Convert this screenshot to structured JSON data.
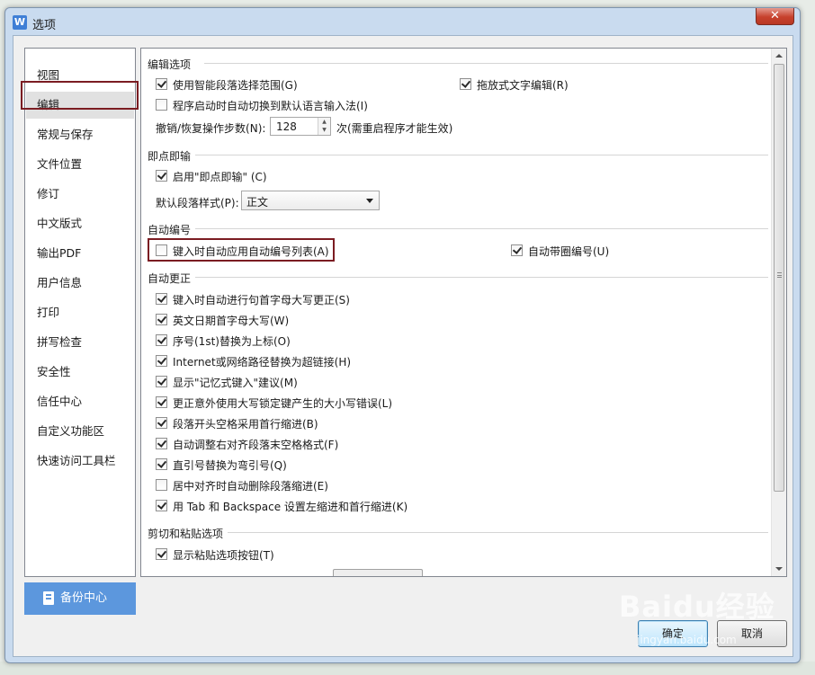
{
  "window": {
    "title": "选项",
    "app_icon_glyph": "W",
    "close_glyph": "✕"
  },
  "nav": {
    "items": [
      {
        "label": "视图"
      },
      {
        "label": "编辑",
        "active": true
      },
      {
        "label": "常规与保存"
      },
      {
        "label": "文件位置"
      },
      {
        "label": "修订"
      },
      {
        "label": "中文版式"
      },
      {
        "label": "输出PDF"
      },
      {
        "label": "用户信息"
      },
      {
        "label": "打印"
      },
      {
        "label": "拼写检查"
      },
      {
        "label": "安全性"
      },
      {
        "label": "信任中心"
      },
      {
        "label": "自定义功能区"
      },
      {
        "label": "快速访问工具栏"
      }
    ],
    "backup_label": "备份中心"
  },
  "edit": {
    "section_title": "编辑选项",
    "smart_select": {
      "label": "使用智能段落选择范围(G)",
      "checked": true
    },
    "drag_edit": {
      "label": "拖放式文字编辑(R)",
      "checked": true
    },
    "auto_ime": {
      "label": "程序启动时自动切换到默认语言输入法(I)",
      "checked": false
    },
    "undo_label": "撤销/恢复操作步数(N):",
    "undo_value": "128",
    "undo_note": "次(需重启程序才能生效)"
  },
  "click_type": {
    "section_title": "即点即输",
    "enable": {
      "label": "启用\"即点即输\" (C)",
      "checked": true
    },
    "default_style_label": "默认段落样式(P):",
    "default_style_value": "正文"
  },
  "auto_numbering": {
    "section_title": "自动编号",
    "apply_list": {
      "label": "键入时自动应用自动编号列表(A)",
      "checked": false
    },
    "circle_number": {
      "label": "自动带圈编号(U)",
      "checked": true
    }
  },
  "autocorrect": {
    "section_title": "自动更正",
    "options": [
      {
        "label": "键入时自动进行句首字母大写更正(S)",
        "checked": true
      },
      {
        "label": "英文日期首字母大写(W)",
        "checked": true
      },
      {
        "label": "序号(1st)替换为上标(O)",
        "checked": true
      },
      {
        "label": "Internet或网络路径替换为超链接(H)",
        "checked": true
      },
      {
        "label": "显示\"记忆式键入\"建议(M)",
        "checked": true
      },
      {
        "label": "更正意外使用大写锁定键产生的大小写错误(L)",
        "checked": true
      },
      {
        "label": "段落开头空格采用首行缩进(B)",
        "checked": true
      },
      {
        "label": "自动调整右对齐段落末空格格式(F)",
        "checked": true
      },
      {
        "label": "直引号替换为弯引号(Q)",
        "checked": true
      },
      {
        "label": "居中对齐时自动删除段落缩进(E)",
        "checked": false
      },
      {
        "label": "用 Tab 和 Backspace 设置左缩进和首行缩进(K)",
        "checked": true
      }
    ]
  },
  "paste": {
    "section_title": "剪切和粘贴选项",
    "show_button": {
      "label": "显示粘贴选项按钮(T)",
      "checked": true
    }
  },
  "footer": {
    "ok_label": "确定",
    "cancel_label": "取消"
  },
  "watermark": {
    "text": "Baidu经验",
    "sub": "jingyan.baidu.com"
  }
}
